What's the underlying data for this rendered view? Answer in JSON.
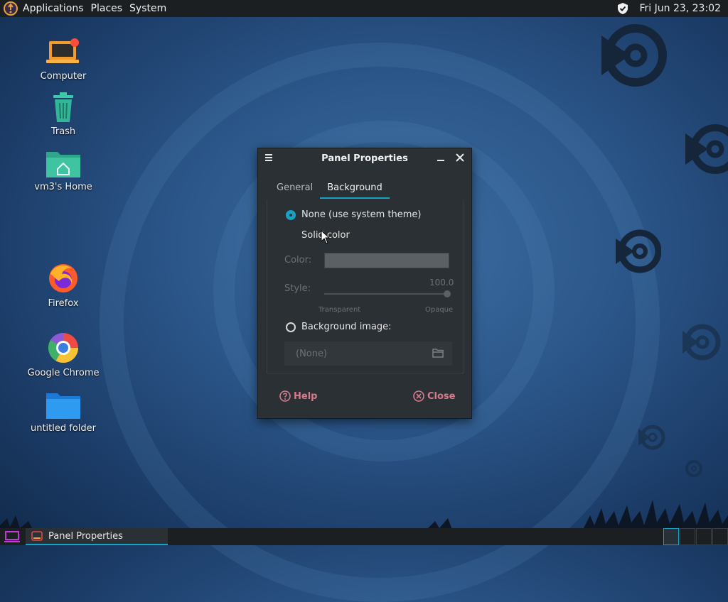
{
  "top_panel": {
    "menus": [
      "Applications",
      "Places",
      "System"
    ],
    "clock": "Fri Jun 23, 23:02"
  },
  "desktop": {
    "icons": [
      {
        "label": "Computer"
      },
      {
        "label": "Trash"
      },
      {
        "label": "vm3's Home"
      },
      {
        "label": "Firefox"
      },
      {
        "label": "Google Chrome"
      },
      {
        "label": "untitled folder"
      }
    ]
  },
  "dialog": {
    "title": "Panel Properties",
    "tabs": [
      {
        "label": "General"
      },
      {
        "label": "Background"
      }
    ],
    "active_tab": "Background",
    "options": {
      "none_label": "None (use system theme)",
      "solid_label": "Solid color",
      "color_label": "Color:",
      "style_label": "Style:",
      "style_value": "100.0",
      "transparent_label": "Transparent",
      "opaque_label": "Opaque",
      "image_label": "Background image:",
      "image_value": "(None)"
    },
    "selected_option": "none",
    "help_label": "Help",
    "close_label": "Close"
  },
  "bottom_panel": {
    "task_label": "Panel Properties",
    "workspace_count": 4,
    "active_workspace": 1
  },
  "colors": {
    "accent": "#17a3c4",
    "panel_bg": "#1c1f21",
    "dialog_bg": "#2b3034",
    "button_pink": "#d67b8d"
  }
}
